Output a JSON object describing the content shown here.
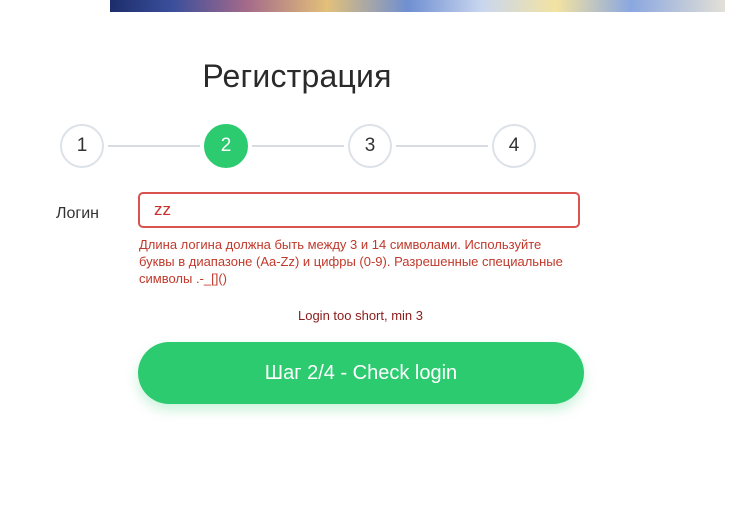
{
  "form": {
    "title": "Регистрация",
    "steps": [
      {
        "label": "1",
        "active": false
      },
      {
        "label": "2",
        "active": true
      },
      {
        "label": "3",
        "active": false
      },
      {
        "label": "4",
        "active": false
      }
    ],
    "login_label": "Логин",
    "login_value": "zz",
    "login_hint": "Длина логина должна быть между 3 и 14 символами. Используйте буквы в диапазоне (Aa-Zz) и цифры (0-9). Разрешенные специальные символы .-_[]()",
    "error_message": "Login too short, min 3",
    "submit_label": "Шаг 2/4 - Check login"
  },
  "colors": {
    "accent": "#2ccb6f",
    "error": "#d9534f",
    "step_border": "#dde1e8"
  }
}
